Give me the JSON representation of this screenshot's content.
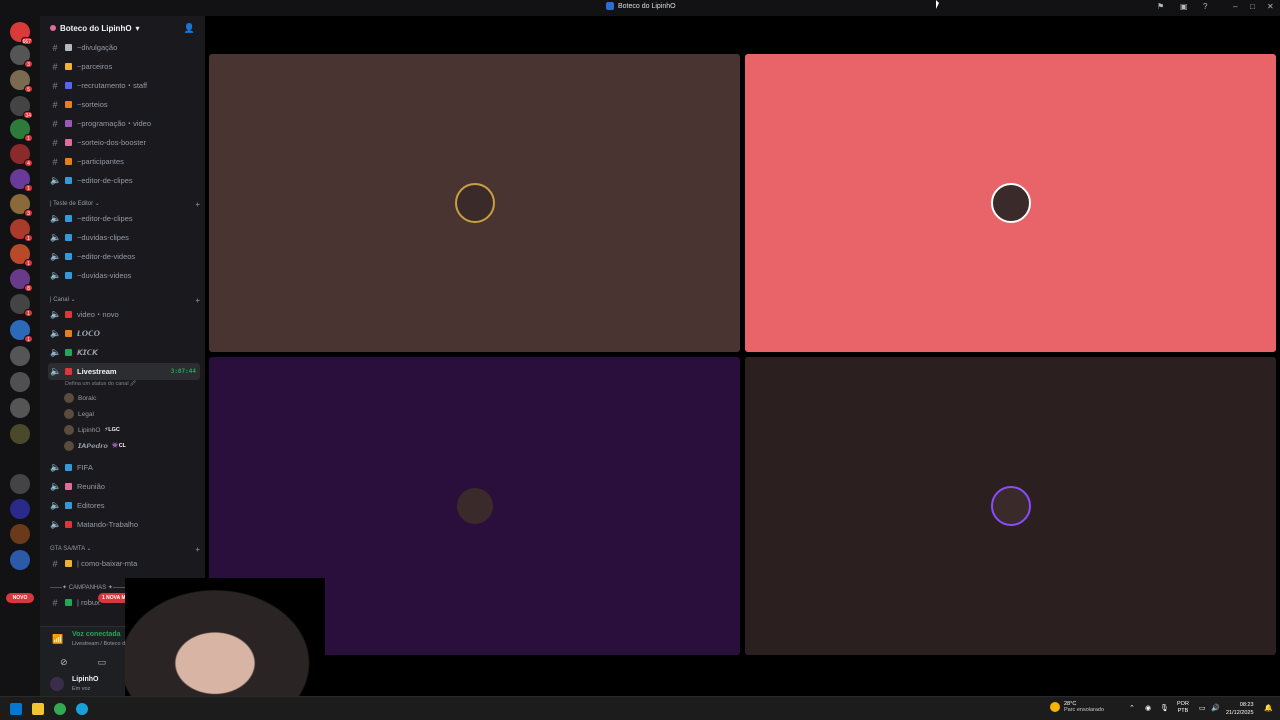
{
  "window": {
    "title": "Boteco do LipinhO"
  },
  "server": {
    "name": "Boteco do LipinhO",
    "chevron": "▾"
  },
  "rail_badges": [
    "667",
    "3",
    "5",
    "34",
    "1",
    "4",
    "1",
    "3",
    "1",
    "1",
    "8",
    "1",
    "1"
  ],
  "novo_label": "NOVO",
  "mention_label": "1 NOVA MENÇÃO",
  "channels_top": [
    {
      "label": "~divulgação",
      "color": "#b5bac1"
    },
    {
      "label": "~parceiros",
      "color": "#f0b232"
    },
    {
      "label": "~recrutamento・staff",
      "color": "#5865f2"
    },
    {
      "label": "~sorteios",
      "color": "#e67e22"
    },
    {
      "label": "~programação・video",
      "color": "#9b59b6"
    },
    {
      "label": "~sorteio-dos-booster",
      "color": "#e06c9f"
    },
    {
      "label": "~participantes",
      "color": "#e67e22"
    },
    {
      "label": "~editor-de-clipes",
      "color": "#3498db"
    }
  ],
  "cat_editor": "| Teste de Editor ⌄",
  "channels_editor": [
    {
      "label": "~editor-de-clipes",
      "color": "#3498db"
    },
    {
      "label": "~duvidas-clipes",
      "color": "#3498db"
    },
    {
      "label": "~editor-de-videos",
      "color": "#3498db"
    },
    {
      "label": "~duvidas-videos",
      "color": "#3498db"
    }
  ],
  "cat_canal": "| Canal ⌄",
  "channels_canal": [
    {
      "label": "video・novo",
      "color": "#da373c"
    },
    {
      "label": "𝙇𝙊𝘾𝙊",
      "color": "#e67e22"
    },
    {
      "label": "𝙆𝙄𝘾𝙆",
      "color": "#23a55a"
    }
  ],
  "live": {
    "label": "Livestream",
    "timer": "3:07:44",
    "status": "Defina um status do canal 🖉"
  },
  "voice_users": [
    {
      "name": "Boraic",
      "tag": ""
    },
    {
      "name": "Legal",
      "tag": ""
    },
    {
      "name": "LipinhO",
      "tag": "⚡LGC"
    },
    {
      "name": "𝙄𝘼𝙋𝙚𝙙𝙧𝙤",
      "tag": "👾CL"
    }
  ],
  "channels_voice": [
    {
      "label": "FIFA",
      "color": "#3498db"
    },
    {
      "label": "Reunião",
      "color": "#e06c9f"
    },
    {
      "label": "Editores",
      "color": "#3498db"
    },
    {
      "label": "Matando-Trabalho",
      "color": "#da373c"
    }
  ],
  "cat_gta": "GTA SA/MTA ⌄",
  "channels_gta": [
    {
      "label": "| como-baixar-mta",
      "color": "#f0b232"
    }
  ],
  "cat_camp": "——✦ CAMPANHAS ✦——",
  "channels_camp": [
    {
      "label": "| robux",
      "color": "#23a55a"
    }
  ],
  "voice_panel": {
    "status": "Voz conectada",
    "sub": "Livestream / Boteco do LipinhO"
  },
  "user": {
    "name": "LipinhO",
    "status": "Em voz"
  },
  "tiles": [
    {
      "bg": "#4a3431",
      "ring": "#c9a040"
    },
    {
      "bg": "#e96469",
      "ring": "#ffffff"
    },
    {
      "bg": "#2a0e3c",
      "ring": "#2a0e3c"
    },
    {
      "bg": "#2c1f1f",
      "ring": "#8a4cff"
    }
  ],
  "taskbar": {
    "weather_temp": "28°C",
    "weather_desc": "Parc ensolarado",
    "lang1": "POR",
    "lang2": "PTB",
    "time": "08:23",
    "date": "21/12/2025"
  }
}
